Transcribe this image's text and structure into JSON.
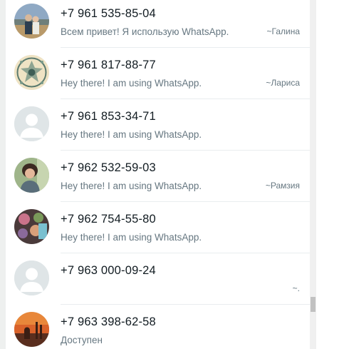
{
  "contacts": [
    {
      "phone": "+7 961 535-85-04",
      "status": "Всем привет! Я использую WhatsApp.",
      "pushname": "~Галина",
      "avatar": "photo-couple"
    },
    {
      "phone": "+7 961 817-88-77",
      "status": "Hey there! I am using WhatsApp.",
      "pushname": "~Лариса",
      "avatar": "photo-ornament"
    },
    {
      "phone": "+7 961 853-34-71",
      "status": "Hey there! I am using WhatsApp.",
      "pushname": "",
      "avatar": "default-avatar"
    },
    {
      "phone": "+7 962 532-59-03",
      "status": "Hey there! I am using WhatsApp.",
      "pushname": "~Рамзия",
      "avatar": "photo-woman"
    },
    {
      "phone": "+7 962 754-55-80",
      "status": "Hey there! I am using WhatsApp.",
      "pushname": "",
      "avatar": "photo-people"
    },
    {
      "phone": "+7 963 000-09-24",
      "status": "",
      "pushname": "~.",
      "avatar": "default-avatar"
    },
    {
      "phone": "+7 963 398-62-58",
      "status": "Доступен",
      "pushname": "",
      "avatar": "photo-mosque"
    }
  ]
}
